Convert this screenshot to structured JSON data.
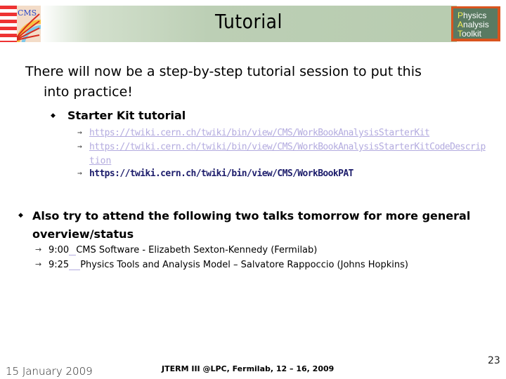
{
  "header": {
    "title": "Tutorial",
    "left_logo": {
      "name": "cms-logo",
      "text": "CMS"
    },
    "right_logo": {
      "name": "physics-analysis-toolkit-logo",
      "lines": [
        {
          "initial": "P",
          "rest": "hysics"
        },
        {
          "initial": "A",
          "rest": "nalysis"
        },
        {
          "initial": "T",
          "rest": "oolkit"
        }
      ]
    }
  },
  "intro": {
    "line1": "There will now be a step-by-step tutorial session to put this",
    "line2": "into practice!"
  },
  "starter_kit": {
    "bullet": "◆",
    "heading": "Starter Kit tutorial",
    "links": [
      {
        "arrow": "→",
        "text": "https://twiki.cern.ch/twiki/bin/view/CMS/WorkBookAnalysisStarterKit",
        "visited": true
      },
      {
        "arrow": "→",
        "text": "https://twiki.cern.ch/twiki/bin/view/CMS/WorkBookAnalysisStarterKitCodeDescrip",
        "continuation": "tion",
        "visited": true
      },
      {
        "arrow": "→",
        "text": "https://twiki.cern.ch/twiki/bin/view/CMS/WorkBookPAT",
        "visited": false
      }
    ]
  },
  "talks": {
    "bullet": "◆",
    "heading_line1": "Also try to attend the following two talks tomorrow for more general",
    "heading_line2": "overview/status",
    "items": [
      {
        "arrow": "→",
        "time": "9:00",
        "text": "CMS Software - Elizabeth Sexton-Kennedy (Fermilab)"
      },
      {
        "arrow": "→",
        "time": "9:25",
        "text": "Physics Tools and Analysis Model – Salvatore Rappoccio (Johns Hopkins)"
      }
    ]
  },
  "footer": {
    "date": "15 January 2009",
    "event": "JTERM III @LPC, Fermilab, 12 – 16, 2009",
    "page_number": "23"
  },
  "colors": {
    "banner": "#b8ccb0",
    "visited_link": "#b3abdf",
    "link": "#1c1c6b",
    "pat_board": "#5a7a62",
    "pat_frame": "#d9541e",
    "pat_initial": "#f5f056"
  }
}
